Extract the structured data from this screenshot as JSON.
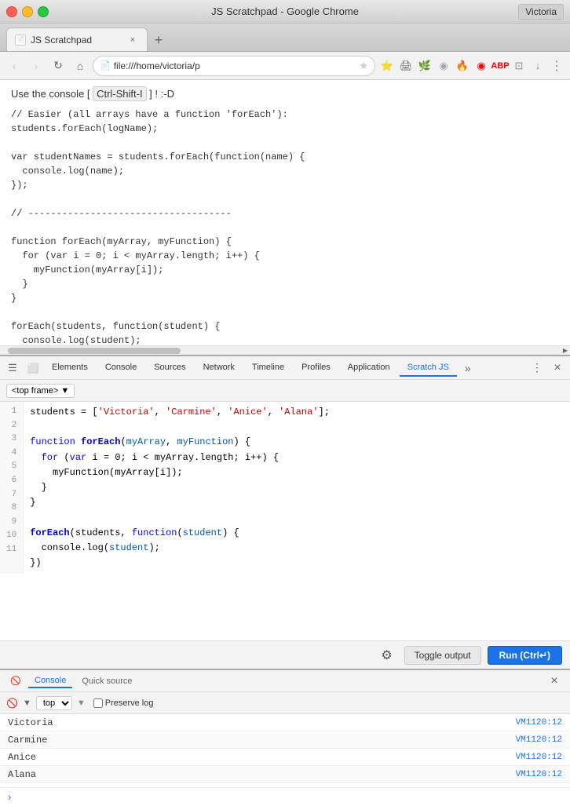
{
  "window": {
    "title": "JS Scratchpad - Google Chrome",
    "user": "Victoria"
  },
  "tab": {
    "label": "JS Scratchpad",
    "close_icon": "×",
    "new_tab_icon": "+"
  },
  "navbar": {
    "back_icon": "‹",
    "forward_icon": "›",
    "reload_icon": "↻",
    "home_icon": "⌂",
    "url": "file:///home/victoria/p",
    "star_icon": "★",
    "menu_icon": "⋮"
  },
  "page": {
    "hint": "Use the console [ Ctrl-Shift-I ] ! :-D",
    "code": "// Easier (all arrays have a function 'forEach'):\nstudents.forEach(logName);\n\nvar studentNames = students.forEach(function(name) {\n  console.log(name);\n});\n\n// ------------------------------------\n\nfunction forEach(myArray, myFunction) {\n  for (var i = 0; i < myArray.length; i++) {\n    myFunction(myArray[i]);\n  }\n}\n\nforEach(students, function(student) {\n  console.log(student);\n})\n\n// ------------------------------------"
  },
  "devtools": {
    "tabs": [
      {
        "label": "Elements",
        "active": false
      },
      {
        "label": "Console",
        "active": false
      },
      {
        "label": "Sources",
        "active": false
      },
      {
        "label": "Network",
        "active": false
      },
      {
        "label": "Timeline",
        "active": false
      },
      {
        "label": "Profiles",
        "active": false
      },
      {
        "label": "Application",
        "active": false
      },
      {
        "label": "Scratch JS",
        "active": true
      }
    ],
    "more_icon": "»",
    "settings_icon": "⋮",
    "close_icon": "×"
  },
  "scratchpad": {
    "frame_select": "<top frame>",
    "frame_arrow": "▼",
    "lines": [
      {
        "num": 1,
        "content": "students = ['Victoria', 'Carmine', 'Anice', 'Alana'];"
      },
      {
        "num": 2,
        "content": ""
      },
      {
        "num": 3,
        "content": "function forEach(myArray, myFunction) {"
      },
      {
        "num": 4,
        "content": "  for (var i = 0; i < myArray.length; i++) {"
      },
      {
        "num": 5,
        "content": "    myFunction(myArray[i]);"
      },
      {
        "num": 6,
        "content": "  }"
      },
      {
        "num": 7,
        "content": "}"
      },
      {
        "num": 8,
        "content": ""
      },
      {
        "num": 9,
        "content": "forEach(students, function(student) {"
      },
      {
        "num": 10,
        "content": "  console.log(student);"
      },
      {
        "num": 11,
        "content": "})"
      }
    ],
    "gear_icon": "⚙",
    "toggle_output_label": "Toggle output",
    "run_label": "Run (Ctrl↵)"
  },
  "console": {
    "tabs": [
      {
        "label": "Console",
        "active": true
      },
      {
        "label": "Quick source",
        "active": false
      }
    ],
    "close_icon": "×",
    "filter_icon": "🔍",
    "top_label": "top",
    "preserve_log_label": "Preserve log",
    "entries": [
      {
        "text": "Victoria",
        "source": "VM1120:12"
      },
      {
        "text": "Carmine",
        "source": "VM1120:12"
      },
      {
        "text": "Anice",
        "source": "VM1120:12"
      },
      {
        "text": "Alana",
        "source": "VM1120:12"
      }
    ],
    "prompt_icon": "›"
  }
}
